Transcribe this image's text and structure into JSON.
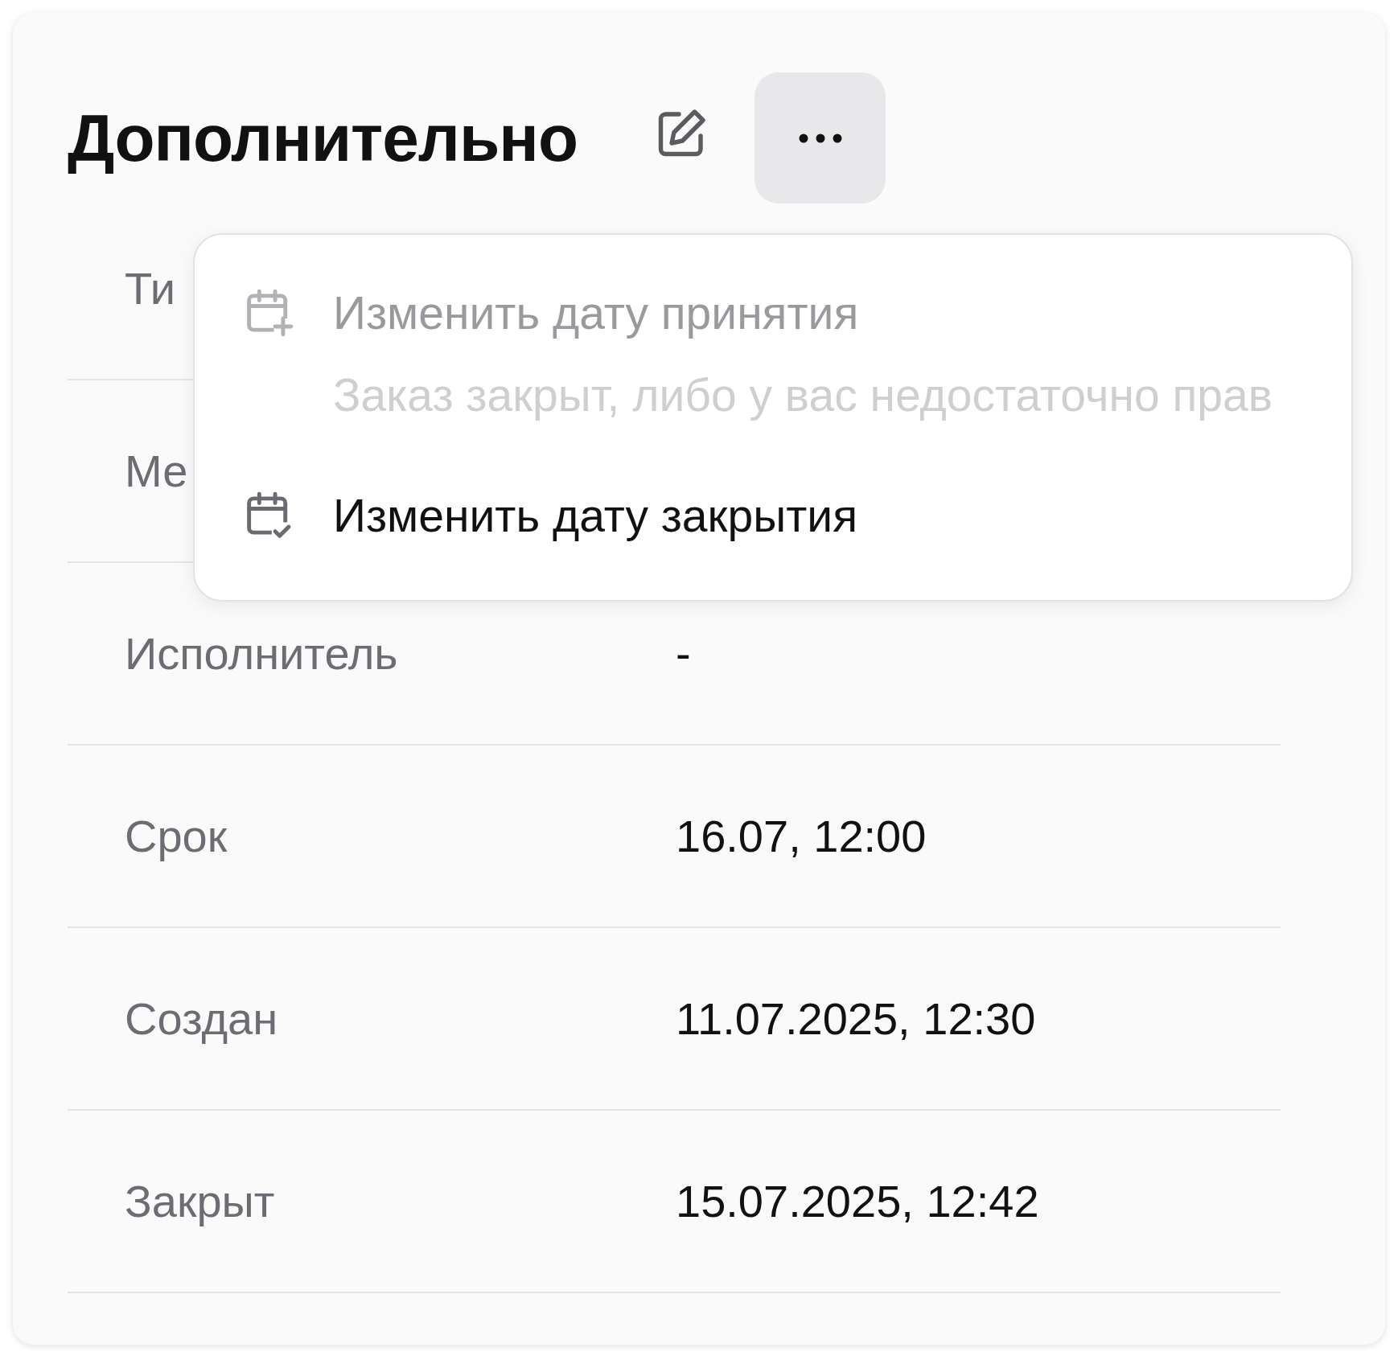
{
  "header": {
    "title": "Дополнительно",
    "more_button": {
      "expanded": true
    }
  },
  "fields": [
    {
      "label": "Ти"
    },
    {
      "label": "Ме"
    },
    {
      "label": "Исполнитель",
      "value": "-"
    },
    {
      "label": "Срок",
      "value": "16.07, 12:00"
    },
    {
      "label": "Создан",
      "value": "11.07.2025, 12:30"
    },
    {
      "label": "Закрыт",
      "value": "15.07.2025, 12:42"
    }
  ],
  "menu": {
    "items": [
      {
        "kind": "add",
        "label": "Изменить дату принятия",
        "hint": "Заказ закрыт, либо у вас недостаточно прав",
        "disabled": true
      },
      {
        "kind": "confirm",
        "label": "Изменить дату закрытия",
        "disabled": false
      }
    ]
  }
}
